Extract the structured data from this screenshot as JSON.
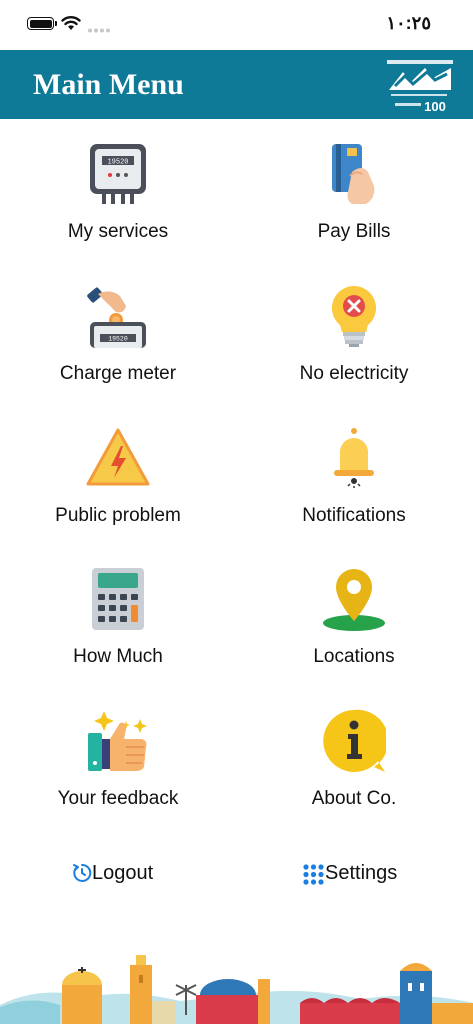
{
  "status_bar": {
    "time": "١٠:٢٥"
  },
  "header": {
    "title": "Main Menu",
    "logo_text": "100"
  },
  "menu": [
    {
      "label": "My services",
      "icon": "electric-meter-icon"
    },
    {
      "label": "Pay Bills",
      "icon": "credit-card-hand-icon"
    },
    {
      "label": "Charge meter",
      "icon": "coin-meter-icon"
    },
    {
      "label": "No electricity",
      "icon": "broken-bulb-icon"
    },
    {
      "label": "Public problem",
      "icon": "warning-lightning-icon"
    },
    {
      "label": "Notifications",
      "icon": "bell-icon"
    },
    {
      "label": "How Much",
      "icon": "calculator-icon"
    },
    {
      "label": "Locations",
      "icon": "map-pin-icon"
    },
    {
      "label": "Your feedback",
      "icon": "thumbs-up-icon"
    },
    {
      "label": "About Co.",
      "icon": "info-bubble-icon"
    }
  ],
  "bottom": {
    "logout_label": "Logout",
    "settings_label": "Settings"
  },
  "colors": {
    "header_bg": "#0f7a98",
    "accent_blue": "#1a7fe0",
    "yellow": "#f5c518"
  }
}
